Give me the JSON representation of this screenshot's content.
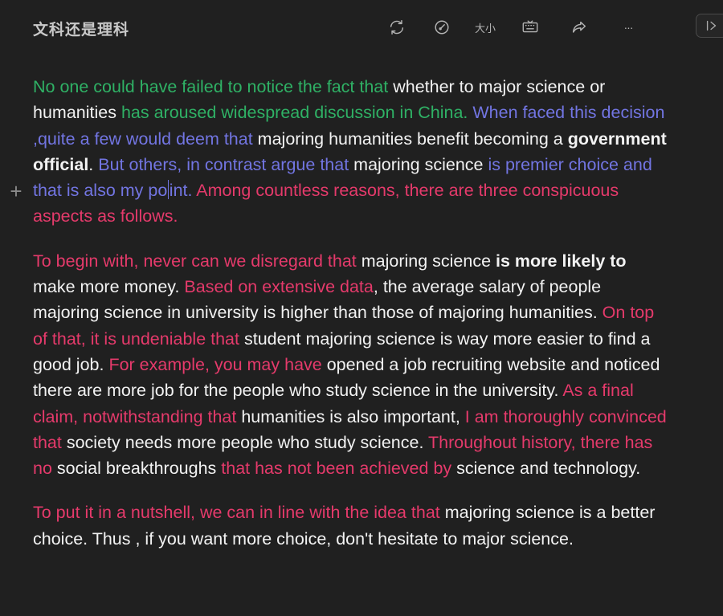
{
  "header": {
    "title": "文科还是理科",
    "tools": [
      {
        "name": "sync-icon",
        "label": ""
      },
      {
        "name": "compass-icon",
        "label": ""
      },
      {
        "name": "font-size-icon",
        "label": "大小"
      },
      {
        "name": "keyboard-icon",
        "label": ""
      },
      {
        "name": "share-icon",
        "label": ""
      },
      {
        "name": "more-icon",
        "label": "···"
      }
    ],
    "panel_toggle": "|>"
  },
  "editor": {
    "gutter_plus": "+",
    "paragraphs": [
      {
        "segments": [
          {
            "text": "No one could have failed to notice the fact that ",
            "color": "green"
          },
          {
            "text": "whether to major science or humanities ",
            "color": "white"
          },
          {
            "text": "has aroused widespread discussion in China. ",
            "color": "green"
          },
          {
            "text": "When faced this decision ,quite a few would deem that ",
            "color": "blue"
          },
          {
            "text": "majoring humanities benefit becoming a ",
            "color": "white"
          },
          {
            "text": "government official",
            "color": "white",
            "bold": true
          },
          {
            "text": ". ",
            "color": "white"
          },
          {
            "text": "But others, in contrast argue that ",
            "color": "blue"
          },
          {
            "text": "majoring science ",
            "color": "white"
          },
          {
            "text": "is premier choice and that is also my po",
            "color": "blue",
            "cursor_after": true
          },
          {
            "text": "int. ",
            "color": "blue"
          },
          {
            "text": "Among countless reasons, there are three conspicuous aspects as follows.",
            "color": "red"
          }
        ]
      },
      {
        "segments": [
          {
            "text": "To begin with, never can we disregard that ",
            "color": "red"
          },
          {
            "text": "majoring science ",
            "color": "white"
          },
          {
            "text": "is more likely to",
            "color": "white",
            "bold": true
          },
          {
            "text": " make more money. ",
            "color": "white"
          },
          {
            "text": "Based on extensive data",
            "color": "red"
          },
          {
            "text": ", the average salary of people majoring science in university is higher than those of majoring humanities. ",
            "color": "white"
          },
          {
            "text": "On top of that, it is undeniable that ",
            "color": "red"
          },
          {
            "text": "student majoring science is way more easier to find a good job. ",
            "color": "white"
          },
          {
            "text": "For example, you may have ",
            "color": "red"
          },
          {
            "text": "opened a job recruiting website and noticed there are more job for the people who study science in the university. ",
            "color": "white"
          },
          {
            "text": "As a final claim, notwithstanding that ",
            "color": "red"
          },
          {
            "text": "humanities is also important, ",
            "color": "white"
          },
          {
            "text": "I am thoroughly convinced that ",
            "color": "red"
          },
          {
            "text": "society needs more people who study science. ",
            "color": "white"
          },
          {
            "text": "Throughout history, there has no ",
            "color": "red"
          },
          {
            "text": "social breakthroughs ",
            "color": "white"
          },
          {
            "text": "that has not been achieved by ",
            "color": "red"
          },
          {
            "text": "science and technology.",
            "color": "white"
          }
        ]
      },
      {
        "segments": [
          {
            "text": "To put it in a nutshell, we can in line with the idea that ",
            "color": "red"
          },
          {
            "text": "majoring science is a better choice. Thus , if you want more choice, don't hesitate to major science.",
            "color": "white"
          }
        ]
      }
    ]
  },
  "colors": {
    "background": "#202020",
    "green": "#2fb165",
    "blue": "#7275e2",
    "red": "#e53a6b",
    "white": "#f2f2f2"
  }
}
